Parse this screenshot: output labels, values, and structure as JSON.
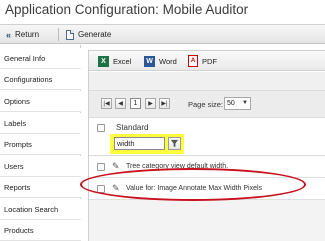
{
  "window": {
    "title": "Application Configuration: Mobile Auditor"
  },
  "toolbar": {
    "return_label": "Return",
    "generate_label": "Generate"
  },
  "sidebar": {
    "items": [
      {
        "label": "General Info"
      },
      {
        "label": "Configurations"
      },
      {
        "label": "Options"
      },
      {
        "label": "Labels"
      },
      {
        "label": "Prompts"
      },
      {
        "label": "Users"
      },
      {
        "label": "Reports"
      },
      {
        "label": "Location Search"
      },
      {
        "label": "Products"
      }
    ],
    "active": "Labels"
  },
  "export": {
    "excel_label": "Excel",
    "word_label": "Word",
    "pdf_label": "PDF"
  },
  "pager": {
    "current_page": "1",
    "page_size_label": "Page size:",
    "page_size_value": "50"
  },
  "grid": {
    "column_header": "Standard",
    "filter_value": "width",
    "rows": [
      {
        "text": "Tree category view default width."
      },
      {
        "text": "Value for: Image Annotate Max Width Pixels"
      }
    ]
  },
  "colors": {
    "highlight": "#ffff3f",
    "annotation": "#c8101e"
  }
}
